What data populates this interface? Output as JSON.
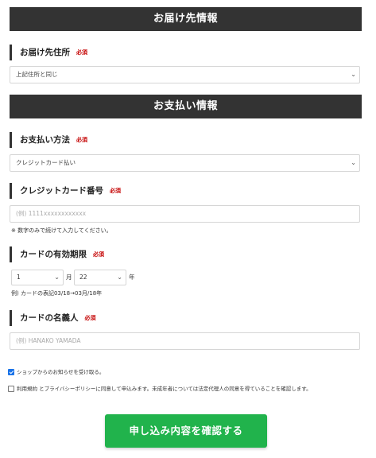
{
  "delivery": {
    "section_title": "お届け先情報",
    "address_label": "お届け先住所",
    "required": "必須",
    "address_value": "上記住所と同じ"
  },
  "payment": {
    "section_title": "お支払い情報",
    "method_label": "お支払い方法",
    "method_value": "クレジットカード払い",
    "card_number_label": "クレジットカード番号",
    "card_number_placeholder": "(例) 1111xxxxxxxxxxxx",
    "card_number_note": "※ 数字のみで続けて入力してください。",
    "expiry_label": "カードの有効期限",
    "expiry_month": "1",
    "month_unit": "月",
    "expiry_year": "22",
    "year_unit": "年",
    "expiry_example": "例) カードの表記03/18→03月/18年",
    "holder_label": "カードの名義人",
    "holder_placeholder": "(例) HANAKO YAMADA"
  },
  "consents": {
    "newsletter": "ショップからのお知らせを受け取る。",
    "newsletter_checked": true,
    "terms": "利用規約 とプライバシーポリシーに同意して申込みます。未成年者については法定代理人の同意を得ていることを確認します。",
    "terms_checked": false
  },
  "submit_label": "申し込み内容を確認する",
  "colors": {
    "band": "#333333",
    "required": "#c40000",
    "submit": "#21b34c",
    "checkbox": "#1a73e8"
  }
}
